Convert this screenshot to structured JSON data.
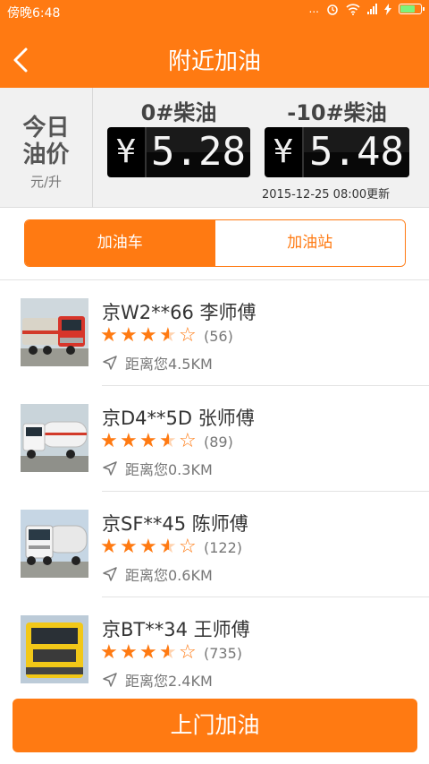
{
  "status": {
    "time": "傍晚6:48",
    "dots": "...",
    "network": "4G"
  },
  "header": {
    "title": "附近加油"
  },
  "prices": {
    "today_line1": "今日",
    "today_line2": "油价",
    "unit": "元/升",
    "diesel0": {
      "label": "0#柴油",
      "currency": "¥",
      "value": "5.28"
    },
    "diesel_neg10": {
      "label": "-10#柴油",
      "currency": "¥",
      "value": "5.48"
    },
    "updated": "2015-12-25 08:00更新"
  },
  "tabs": [
    {
      "label": "加油车",
      "active": true
    },
    {
      "label": "加油站",
      "active": false
    }
  ],
  "items": [
    {
      "name": "京W2**66 李师傅",
      "rating": 3.5,
      "count": "(56)",
      "distance": "距离您4.5KM"
    },
    {
      "name": "京D4**5D 张师傅",
      "rating": 3.5,
      "count": "(89)",
      "distance": "距离您0.3KM"
    },
    {
      "name": "京SF**45 陈师傅",
      "rating": 3.5,
      "count": "(122)",
      "distance": "距离您0.6KM"
    },
    {
      "name": "京BT**34 王师傅",
      "rating": 3.5,
      "count": "(735)",
      "distance": "距离您2.4KM"
    }
  ],
  "cta": {
    "label": "上门加油"
  },
  "colors": {
    "accent": "#ff7a12",
    "price_board": "#000000",
    "battery": "#7cf27c"
  },
  "icons": [
    "back-arrow-icon",
    "alarm-icon",
    "wifi-icon",
    "signal-icon",
    "charging-icon",
    "battery-icon",
    "star-icon",
    "location-arrow-icon"
  ]
}
